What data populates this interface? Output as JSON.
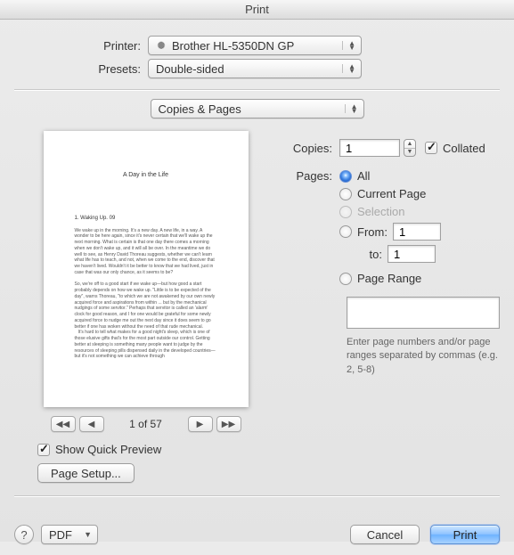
{
  "title": "Print",
  "printer": {
    "label": "Printer:",
    "value": "Brother HL-5350DN GP"
  },
  "presets": {
    "label": "Presets:",
    "value": "Double-sided"
  },
  "section_select": "Copies & Pages",
  "copies": {
    "label": "Copies:",
    "value": "1",
    "collated_label": "Collated"
  },
  "pages": {
    "label": "Pages:",
    "all": "All",
    "current": "Current Page",
    "selection": "Selection",
    "from": "From:",
    "to": "to:",
    "from_value": "1",
    "to_value": "1"
  },
  "page_range": {
    "label": "Page Range",
    "hint": "Enter page numbers and/or page ranges separated by commas (e.g. 2, 5-8)"
  },
  "preview": {
    "doc_title": "A Day in the Life",
    "section": "1. Waking Up. 09",
    "counter": "1 of 57",
    "show_quick_preview": "Show Quick Preview",
    "page_setup": "Page Setup..."
  },
  "footer": {
    "pdf": "PDF",
    "cancel": "Cancel",
    "print": "Print"
  }
}
